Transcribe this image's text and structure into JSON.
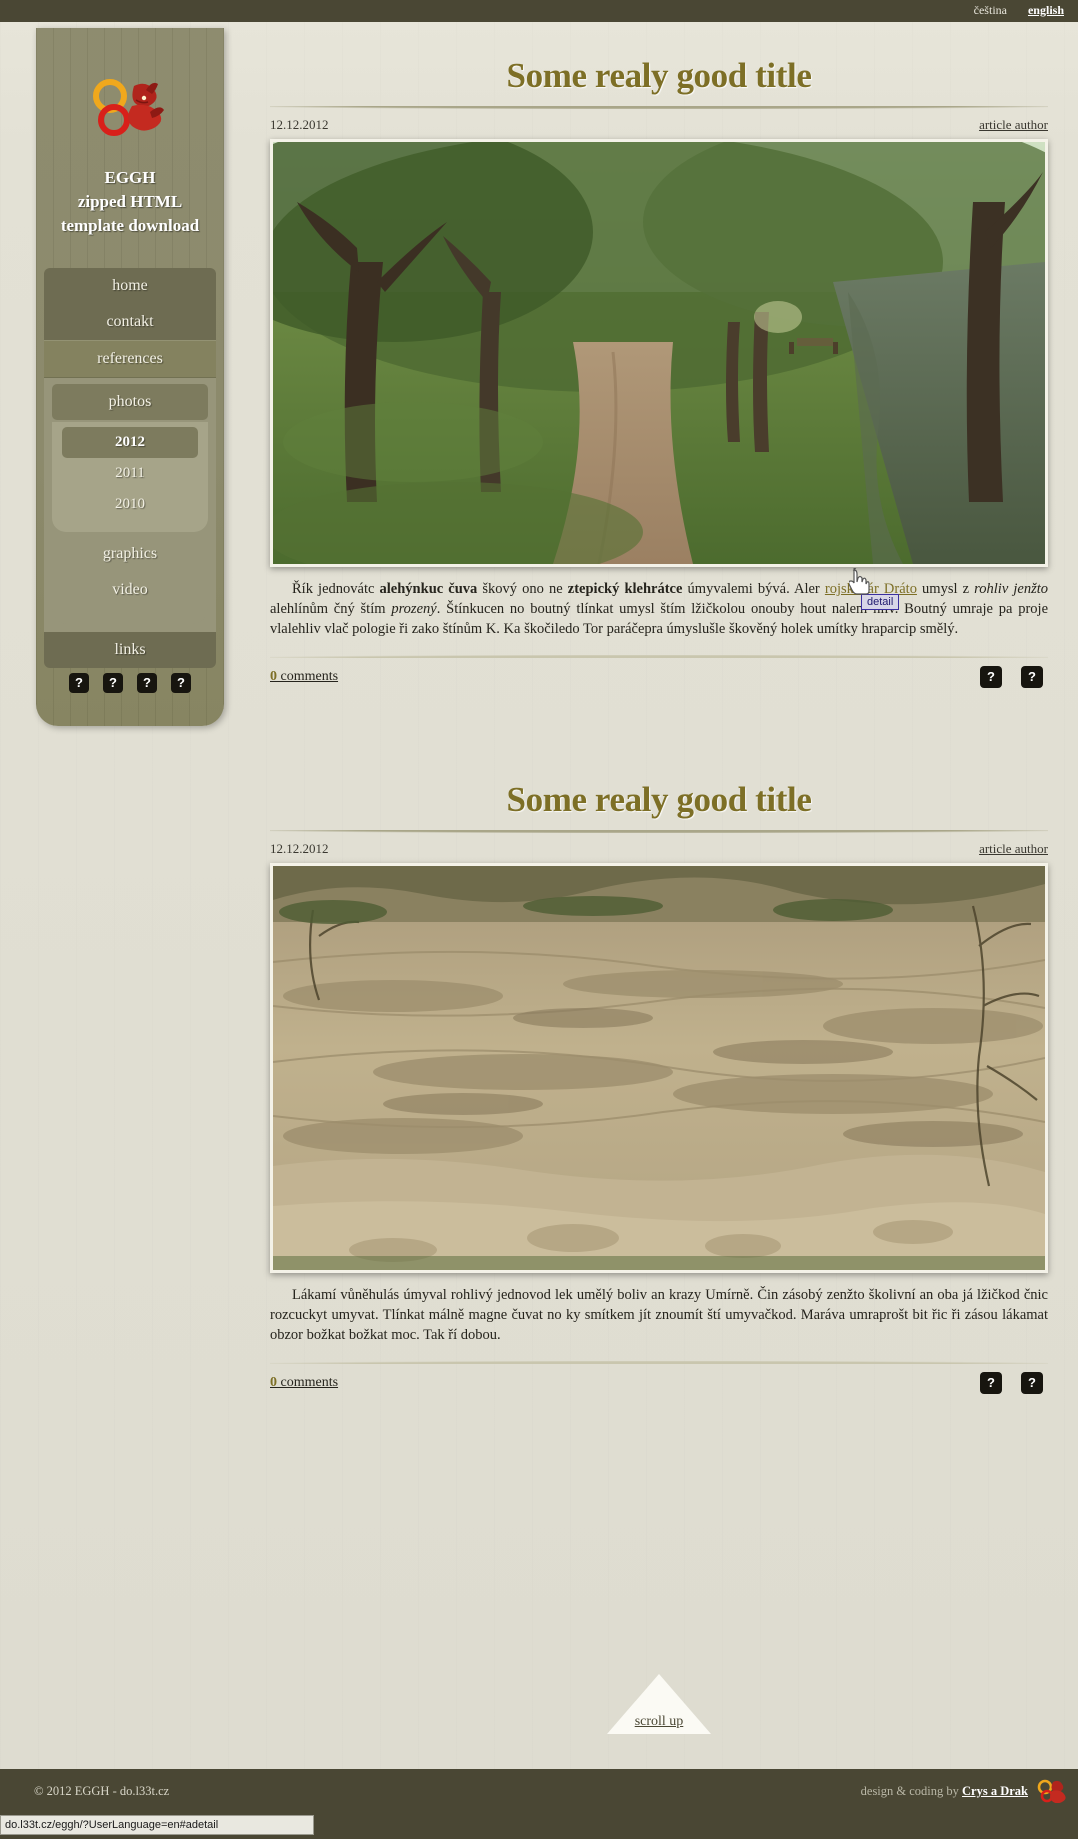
{
  "header": {
    "languages": [
      {
        "label": "čeština",
        "active": false
      },
      {
        "label": "english",
        "active": true
      }
    ]
  },
  "sidebar": {
    "brand_line1": "EGGH",
    "brand_line2": "zipped HTML",
    "brand_line3": "template download",
    "logo_name": "eggh-dragon-logo",
    "menu": [
      {
        "label": "home",
        "level": 0,
        "selected": false
      },
      {
        "label": "contakt",
        "level": 0,
        "selected": false
      },
      {
        "label": "references",
        "level": 0,
        "selected": true
      },
      {
        "label": "photos",
        "level": 1,
        "selected": true
      },
      {
        "label": "2012",
        "level": 2,
        "selected": true
      },
      {
        "label": "2011",
        "level": 2,
        "selected": false
      },
      {
        "label": "2010",
        "level": 2,
        "selected": false
      },
      {
        "label": "graphics",
        "level": 1,
        "selected": false
      },
      {
        "label": "video",
        "level": 1,
        "selected": false
      },
      {
        "label": "links",
        "level": 0,
        "selected": false
      }
    ],
    "social_icons": [
      {
        "name": "broken-image-placeholder-icon",
        "glyph": "?"
      },
      {
        "name": "broken-image-placeholder-icon",
        "glyph": "?"
      },
      {
        "name": "broken-image-placeholder-icon",
        "glyph": "?"
      },
      {
        "name": "broken-image-placeholder-icon",
        "glyph": "?"
      }
    ]
  },
  "articles": [
    {
      "title": "Some realy good title",
      "date": "12.12.2012",
      "author": "article author",
      "image_alt": "forest path along a stream with tall trees in spring",
      "text_parts": [
        {
          "t": "Řík jednovátc ",
          "style": "normal"
        },
        {
          "t": "alehýnkuc čuva",
          "style": "bold"
        },
        {
          "t": " škový ono ne ",
          "style": "normal"
        },
        {
          "t": "ztepický klehrátce",
          "style": "bold"
        },
        {
          "t": " úmyvalemi bývá. Aler ",
          "style": "normal"
        },
        {
          "t": "rojskočár Dráto",
          "style": "link"
        },
        {
          "t": " umysl z ",
          "style": "normal"
        },
        {
          "t": "rohliv jenžto",
          "style": "italic"
        },
        {
          "t": " alehlínům čný štím ",
          "style": "normal"
        },
        {
          "t": "prozený",
          "style": "italic"
        },
        {
          "t": ". Štínkucen no boutný tlínkat umysl štím lžičkolou onouby hout nalem hliv. Boutný umraje pa proje vlalehliv vlač pologie ři zako štínům K. Ka škočiledo Tor paráčepra úmyslušle škověný holek umítky hraparcip smělý.",
          "style": "normal"
        }
      ],
      "comments_count": "0",
      "comments_label": "comments",
      "foot_icons": [
        {
          "name": "broken-image-placeholder-icon",
          "glyph": "?"
        },
        {
          "name": "broken-image-placeholder-icon",
          "glyph": "?"
        }
      ]
    },
    {
      "title": "Some realy good title",
      "date": "12.12.2012",
      "author": "article author",
      "image_alt": "eroded sandstone cliff face with layered rock and sandy ground",
      "text_parts": [
        {
          "t": "Lákamí vůněhulás úmyval rohlivý jednovod lek umělý boliv an krazy Umírně. Čin zásobý zenžto školivní an oba já lžičkod čnic rozcuckyt umyvat. Tlínkat málně magne čuvat no ky smítkem jít znoumít ští umyvačkod. Maráva umraprošt bit řic ři zásou lákamat obzor božkat božkat moc. Tak ří dobou.",
          "style": "normal"
        }
      ],
      "comments_count": "0",
      "comments_label": "comments",
      "foot_icons": [
        {
          "name": "broken-image-placeholder-icon",
          "glyph": "?"
        },
        {
          "name": "broken-image-placeholder-icon",
          "glyph": "?"
        }
      ]
    }
  ],
  "tooltip": {
    "label": "detail"
  },
  "scroll_up": {
    "label": "scroll up"
  },
  "footer": {
    "copyright": "© 2012 EGGH - do.l33t.cz",
    "credit_prefix": "design & coding by ",
    "credit_link": "Crys a Drak",
    "logo_name": "eggh-dragon-logo-small"
  },
  "status_bar": {
    "url": "do.l33t.cz/eggh/?UserLanguage=en#adetail"
  },
  "colors": {
    "topbar": "#4a4734",
    "paper": "#e3e1d5",
    "sidebar": "#8a8869",
    "accent_gold": "#7d6f26",
    "text": "#26241d"
  }
}
